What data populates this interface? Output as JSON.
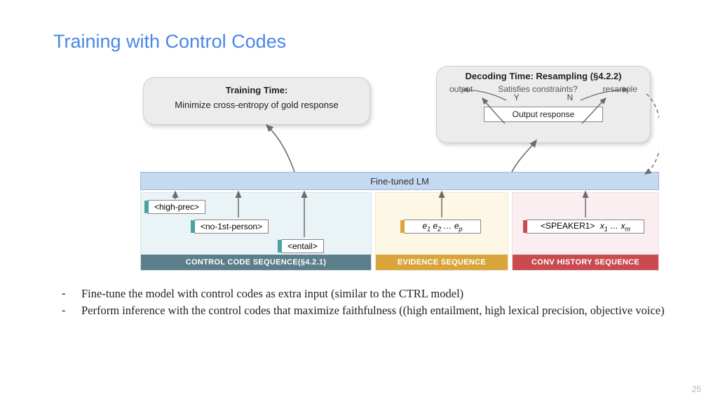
{
  "title": "Training with Control Codes",
  "training_box": {
    "title": "Training Time:",
    "body": "Minimize cross-entropy of gold response"
  },
  "decoding_box": {
    "title": "Decoding Time: Resampling (§4.2.2)",
    "output_label": "output",
    "constraint_label": "Satisfies constraints?",
    "resample_label": "resample",
    "yes": "Y",
    "no": "N",
    "output_response": "Output response"
  },
  "lm_bar": "Fine-tuned LM",
  "regions": {
    "ctrl": {
      "footer": "CONTROL CODE SEQUENCE(§4.2.1)",
      "tokens": [
        "<high-prec>",
        "<no-1st-person>",
        "<entail>"
      ]
    },
    "evi": {
      "footer": "EVIDENCE SEQUENCE",
      "token_html_prefix": "e",
      "token_text": "e₁ e₂ … eₚ"
    },
    "hist": {
      "footer": "CONV HISTORY SEQUENCE",
      "speaker": "<SPEAKER1>",
      "xtail": "x₁ … xₘ"
    }
  },
  "bullets": [
    "Fine-tune the model with control codes as extra input (similar to the CTRL model)",
    "Perform inference with the control codes that maximize faithfulness ((high entailment, high lexical precision, objective voice)"
  ],
  "page_number": "25"
}
